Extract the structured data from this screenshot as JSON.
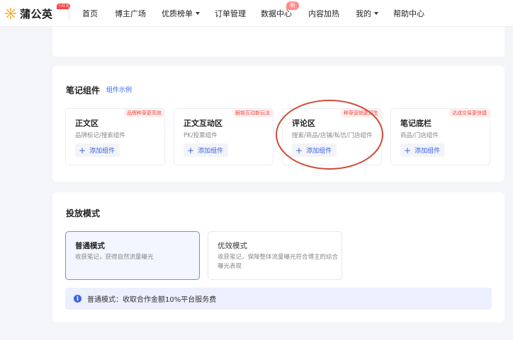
{
  "header": {
    "logo_text": "蒲公英",
    "logo_badge": "小红书",
    "nav": [
      {
        "label": "首页"
      },
      {
        "label": "博主广场"
      },
      {
        "label": "优质榜单"
      },
      {
        "label": "订单管理"
      },
      {
        "label": "数据中心"
      },
      {
        "label": "内容加热"
      },
      {
        "label": "我的"
      },
      {
        "label": "帮助中心"
      }
    ],
    "new_badge": "新"
  },
  "note_components": {
    "title": "笔记组件",
    "example_link": "组件示例",
    "add_label": "添加组件",
    "items": [
      {
        "title": "正文区",
        "tag": "品牌种草更高效",
        "desc": "品牌标记/搜索组件"
      },
      {
        "title": "正文互动区",
        "tag": "解锁互动新玩法",
        "desc": "PK/投票组件"
      },
      {
        "title": "评论区",
        "tag": "种草营销更招生",
        "desc": "搜索/商品/店铺/私信/门店组件"
      },
      {
        "title": "笔记底栏",
        "tag": "达成交易更快捷",
        "desc": "商品/门店组件"
      }
    ]
  },
  "delivery_mode": {
    "title": "投放模式",
    "options": [
      {
        "title": "普通模式",
        "desc": "收获笔记，获得自然流量曝光",
        "selected": true
      },
      {
        "title": "优效模式",
        "desc": "收获笔记，保障整体流量曝光符合博主的综合曝光表现",
        "selected": false
      }
    ],
    "notice": "普通模式：收取合作金额10%平台服务费"
  },
  "colors": {
    "accent": "#3f63e6",
    "tag_red": "#f2453d",
    "annotation_ring": "#cf4a36"
  }
}
